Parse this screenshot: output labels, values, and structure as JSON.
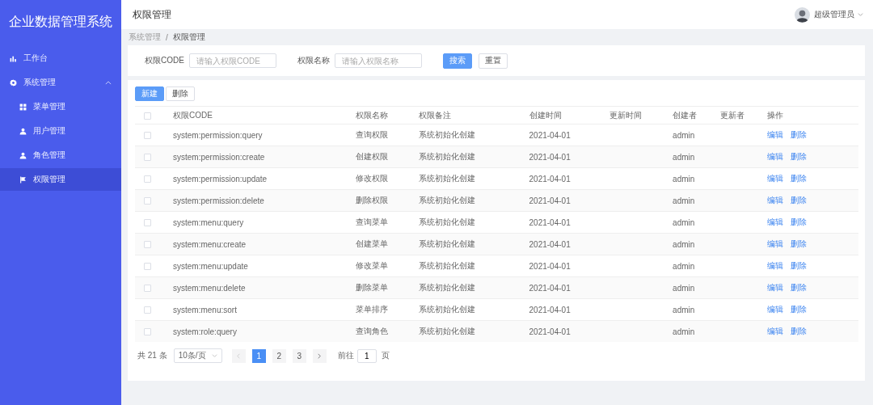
{
  "sidebar": {
    "title": "企业数据管理系统",
    "items": [
      {
        "label": "工作台",
        "selected": false
      },
      {
        "label": "系统管理",
        "expanded": true,
        "selected": false,
        "children": [
          {
            "label": "菜单管理",
            "selected": false
          },
          {
            "label": "用户管理",
            "selected": false
          },
          {
            "label": "角色管理",
            "selected": false
          },
          {
            "label": "权限管理",
            "selected": true
          }
        ]
      }
    ]
  },
  "header": {
    "title": "权限管理",
    "user": "超级管理员"
  },
  "breadcrumb": {
    "items": [
      "系统管理",
      "权限管理"
    ],
    "separator": "/"
  },
  "search": {
    "fields": [
      {
        "label": "权限CODE",
        "placeholder": "请输入权限CODE"
      },
      {
        "label": "权限名称",
        "placeholder": "请输入权限名称"
      }
    ],
    "buttons": [
      {
        "label": "搜索",
        "kind": "primary"
      },
      {
        "label": "重置",
        "kind": "default"
      }
    ]
  },
  "toolbar": [
    {
      "label": "新建",
      "kind": "primary"
    },
    {
      "label": "删除",
      "kind": "default"
    }
  ],
  "table": {
    "all_checked": false,
    "columns": [
      "权限CODE",
      "权限名称",
      "权限备注",
      "创建时间",
      "更新时间",
      "创建者",
      "更新者",
      "操作"
    ],
    "rows": [
      {
        "checked": false,
        "cells": [
          "system:permission:query",
          "查询权限",
          "系统初始化创建",
          "2021-04-01",
          "",
          "admin",
          ""
        ],
        "actions": [
          "编辑",
          "删除"
        ]
      },
      {
        "checked": false,
        "cells": [
          "system:permission:create",
          "创建权限",
          "系统初始化创建",
          "2021-04-01",
          "",
          "admin",
          ""
        ],
        "actions": [
          "编辑",
          "删除"
        ]
      },
      {
        "checked": false,
        "cells": [
          "system:permission:update",
          "修改权限",
          "系统初始化创建",
          "2021-04-01",
          "",
          "admin",
          ""
        ],
        "actions": [
          "编辑",
          "删除"
        ]
      },
      {
        "checked": false,
        "cells": [
          "system:permission:delete",
          "删除权限",
          "系统初始化创建",
          "2021-04-01",
          "",
          "admin",
          ""
        ],
        "actions": [
          "编辑",
          "删除"
        ]
      },
      {
        "checked": false,
        "cells": [
          "system:menu:query",
          "查询菜单",
          "系统初始化创建",
          "2021-04-01",
          "",
          "admin",
          ""
        ],
        "actions": [
          "编辑",
          "删除"
        ]
      },
      {
        "checked": false,
        "cells": [
          "system:menu:create",
          "创建菜单",
          "系统初始化创建",
          "2021-04-01",
          "",
          "admin",
          ""
        ],
        "actions": [
          "编辑",
          "删除"
        ]
      },
      {
        "checked": false,
        "cells": [
          "system:menu:update",
          "修改菜单",
          "系统初始化创建",
          "2021-04-01",
          "",
          "admin",
          ""
        ],
        "actions": [
          "编辑",
          "删除"
        ]
      },
      {
        "checked": false,
        "cells": [
          "system:menu:delete",
          "删除菜单",
          "系统初始化创建",
          "2021-04-01",
          "",
          "admin",
          ""
        ],
        "actions": [
          "编辑",
          "删除"
        ]
      },
      {
        "checked": false,
        "cells": [
          "system:menu:sort",
          "菜单排序",
          "系统初始化创建",
          "2021-04-01",
          "",
          "admin",
          ""
        ],
        "actions": [
          "编辑",
          "删除"
        ]
      },
      {
        "checked": false,
        "cells": [
          "system:role:query",
          "查询角色",
          "系统初始化创建",
          "2021-04-01",
          "",
          "admin",
          ""
        ],
        "actions": [
          "编辑",
          "删除"
        ]
      }
    ]
  },
  "pagination": {
    "total": "共 21 条",
    "page_size": "10条/页",
    "prev_disabled": true,
    "pages": [
      {
        "label": "1",
        "selected": true
      },
      {
        "label": "2",
        "selected": false
      },
      {
        "label": "3",
        "selected": false
      }
    ],
    "goto_label": "前往",
    "goto_value": "1",
    "goto_suffix": "页"
  }
}
